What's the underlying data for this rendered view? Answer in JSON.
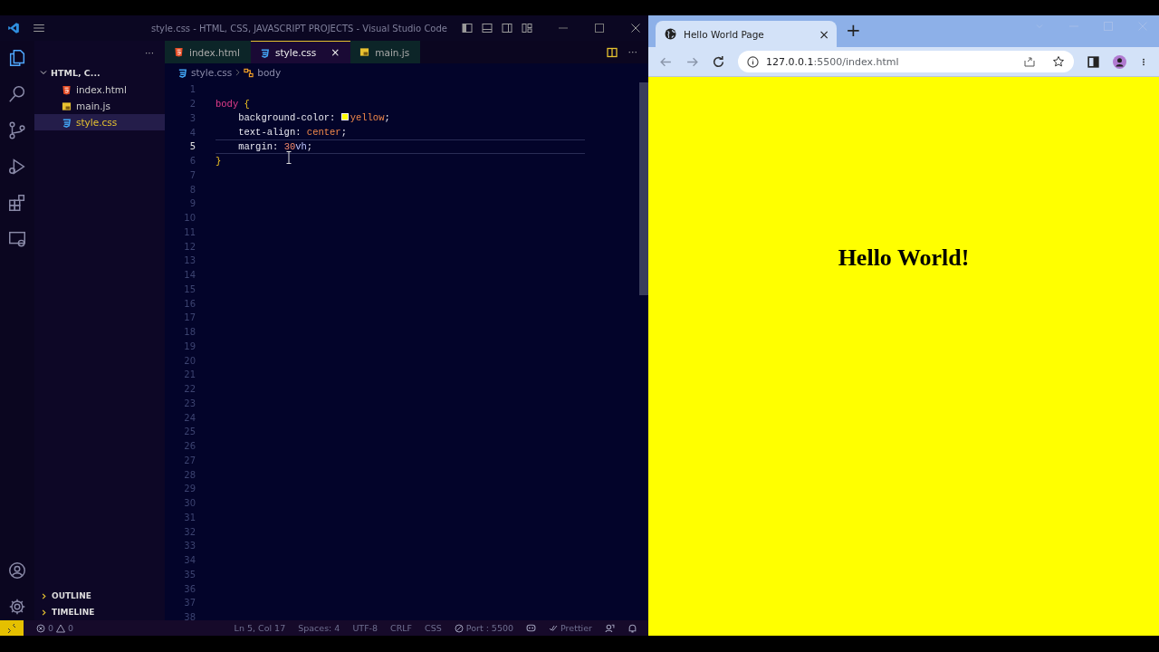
{
  "vscode": {
    "window": {
      "title": "style.css - HTML, CSS, JAVASCRIPT PROJECTS - Visual Studio Code"
    },
    "sidebar": {
      "more": "···",
      "folder": {
        "name": "HTML, C...",
        "expanded": true,
        "files": [
          {
            "name": "index.html",
            "kind": "html",
            "selected": false
          },
          {
            "name": "main.js",
            "kind": "js",
            "selected": false
          },
          {
            "name": "style.css",
            "kind": "css",
            "selected": true
          }
        ]
      },
      "sections": [
        {
          "label": "OUTLINE",
          "expanded": false
        },
        {
          "label": "TIMELINE",
          "expanded": false
        }
      ]
    },
    "tabs": [
      {
        "label": "index.html",
        "kind": "html",
        "selected": false
      },
      {
        "label": "style.css",
        "kind": "css",
        "selected": true,
        "close": "×"
      },
      {
        "label": "main.js",
        "kind": "js",
        "selected": false
      }
    ],
    "tab_actions": {
      "more": "···"
    },
    "breadcrumb": [
      {
        "label": "style.css",
        "kind": "css"
      },
      {
        "label": "body",
        "kind": "symbol"
      }
    ],
    "editor": {
      "lines": [
        {
          "number": "1",
          "selected": false
        },
        {
          "number": "2",
          "selected": false,
          "tokens": [
            {
              "text": "body",
              "kind": "selector"
            },
            {
              "text": " {",
              "kind": "brace"
            }
          ]
        },
        {
          "number": "3",
          "selected": false,
          "tokens": [
            {
              "text": "    background-color: ",
              "kind": "property"
            },
            {
              "text": "yellow",
              "kind": "value",
              "color": "#ffff00"
            },
            {
              "text": ";",
              "kind": "plain"
            }
          ]
        },
        {
          "number": "4",
          "selected": false,
          "tokens": [
            {
              "text": "    text-align: ",
              "kind": "property"
            },
            {
              "text": "center",
              "kind": "value"
            },
            {
              "text": ";",
              "kind": "plain"
            }
          ]
        },
        {
          "number": "5",
          "selected": true,
          "tokens": [
            {
              "text": "    margin: ",
              "kind": "property"
            },
            {
              "text": "30",
              "kind": "number"
            },
            {
              "text": "vh",
              "kind": "unit"
            },
            {
              "text": ";",
              "kind": "plain"
            }
          ]
        },
        {
          "number": "6",
          "selected": false,
          "tokens": [
            {
              "text": "}",
              "kind": "brace"
            }
          ]
        },
        {
          "number": "7",
          "selected": false
        },
        {
          "number": "8",
          "selected": false
        },
        {
          "number": "9",
          "selected": false
        },
        {
          "number": "10",
          "selected": false
        },
        {
          "number": "11",
          "selected": false
        },
        {
          "number": "12",
          "selected": false
        },
        {
          "number": "13",
          "selected": false
        },
        {
          "number": "14",
          "selected": false
        },
        {
          "number": "15",
          "selected": false
        },
        {
          "number": "16",
          "selected": false
        },
        {
          "number": "17",
          "selected": false
        },
        {
          "number": "18",
          "selected": false
        },
        {
          "number": "19",
          "selected": false
        },
        {
          "number": "20",
          "selected": false
        },
        {
          "number": "21",
          "selected": false
        },
        {
          "number": "22",
          "selected": false
        },
        {
          "number": "23",
          "selected": false
        },
        {
          "number": "24",
          "selected": false
        },
        {
          "number": "25",
          "selected": false
        },
        {
          "number": "26",
          "selected": false
        },
        {
          "number": "27",
          "selected": false
        },
        {
          "number": "28",
          "selected": false
        },
        {
          "number": "29",
          "selected": false
        },
        {
          "number": "30",
          "selected": false
        },
        {
          "number": "31",
          "selected": false
        },
        {
          "number": "32",
          "selected": false
        },
        {
          "number": "33",
          "selected": false
        },
        {
          "number": "34",
          "selected": false
        },
        {
          "number": "35",
          "selected": false
        },
        {
          "number": "36",
          "selected": false
        },
        {
          "number": "37",
          "selected": false
        },
        {
          "number": "38",
          "selected": false
        }
      ]
    },
    "status_bar": {
      "errors": "0",
      "warnings": "0",
      "items": [
        "Ln 5, Col 17",
        "Spaces: 4",
        "UTF-8",
        "CRLF",
        "CSS"
      ],
      "port": "Port : 5500",
      "formatter": "Prettier"
    }
  },
  "browser": {
    "tabs": [
      {
        "title": "Hello World Page",
        "selected": true,
        "close": "×"
      }
    ],
    "new_tab": "+",
    "address": {
      "host": "127.0.0.1",
      "path": ":5500/index.html"
    },
    "page": {
      "heading": "Hello World!"
    }
  }
}
